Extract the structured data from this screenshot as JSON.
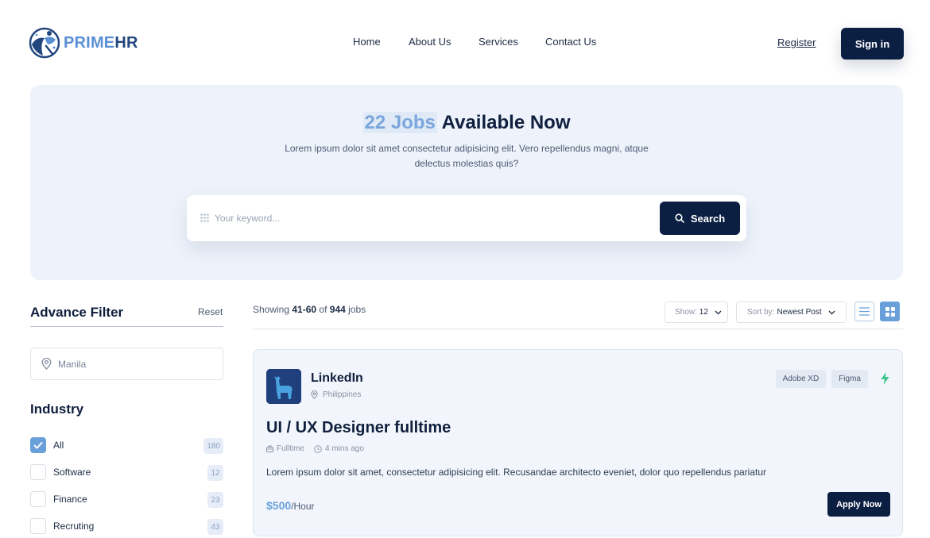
{
  "header": {
    "logo": {
      "part1": "PRIME",
      "part2": "HR"
    },
    "nav": [
      "Home",
      "About Us",
      "Services",
      "Contact Us"
    ],
    "register_label": "Register",
    "signin_label": "Sign in"
  },
  "hero": {
    "title_highlight": "22 Jobs",
    "title_rest": " Available Now",
    "subtitle": "Lorem ipsum dolor sit amet consectetur adipisicing elit. Vero repellendus magni, atque delectus molestias quis?",
    "search": {
      "placeholder": "Your keyword...",
      "button_label": "Search"
    }
  },
  "sidebar": {
    "title": "Advance Filter",
    "reset_label": "Reset",
    "location_placeholder": "Manila",
    "industry_title": "Industry",
    "industries": [
      {
        "label": "All",
        "count": "180",
        "checked": true
      },
      {
        "label": "Software",
        "count": "12",
        "checked": false
      },
      {
        "label": "Finance",
        "count": "23",
        "checked": false
      },
      {
        "label": "Recruting",
        "count": "43",
        "checked": false
      }
    ]
  },
  "results": {
    "showing_prefix": "Showing ",
    "range": "41-60",
    "of": " of ",
    "total": "944",
    "suffix": " jobs",
    "show_label": "Show:",
    "show_value": "12",
    "sort_label": "Sort by:",
    "sort_value": "Newest Post"
  },
  "job": {
    "company": "LinkedIn",
    "location": "Philippines",
    "tags": [
      "Adobe XD",
      "Figma"
    ],
    "title": "UI / UX Designer fulltime",
    "type": "Fulltime",
    "posted": "4 mins ago",
    "description": "Lorem ipsum dolor sit amet, consectetur adipisicing elit. Recusandae architecto eveniet, dolor quo repellendus pariatur",
    "salary": "$500",
    "salary_unit": "/Hour",
    "apply_label": "Apply Now"
  },
  "colors": {
    "navy": "#0b1f43",
    "accent": "#6aa0da",
    "hero_bg": "#eef3fb",
    "bolt": "#3cc48a"
  }
}
